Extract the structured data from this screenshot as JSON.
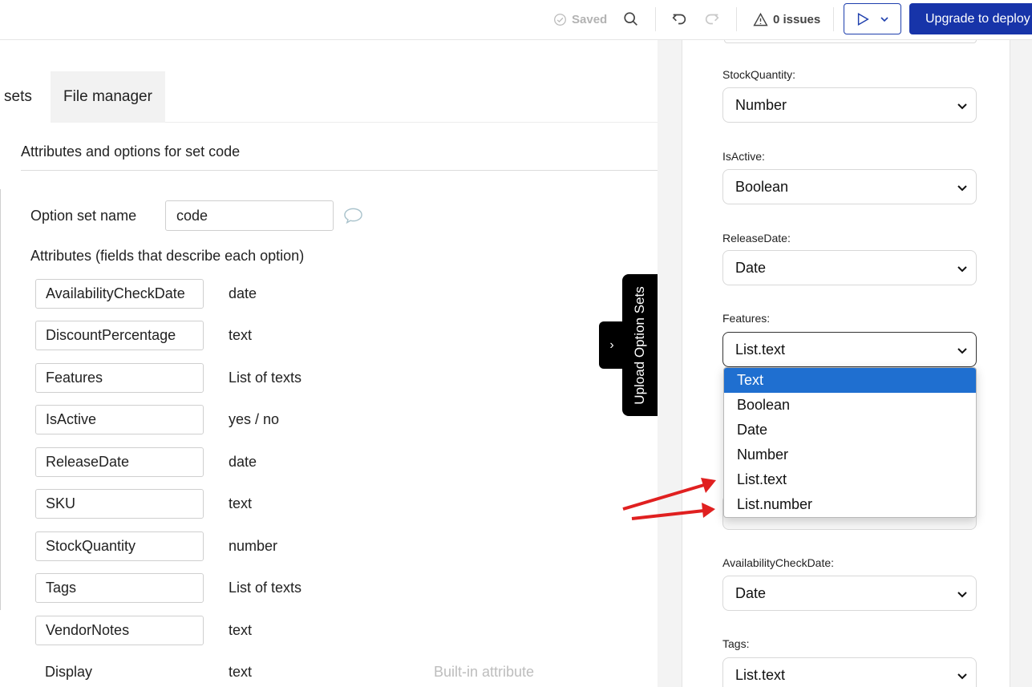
{
  "topbar": {
    "saved_label": "Saved",
    "issues_label": "0 issues",
    "upgrade_label": "Upgrade to deploy"
  },
  "tabs": {
    "sets_label": "sets",
    "file_manager_label": "File manager"
  },
  "editor": {
    "section_title": "Attributes and options for set code",
    "option_set_name_label": "Option set name",
    "option_set_name_value": "code",
    "attributes_label": "Attributes (fields that describe each option)",
    "attributes": [
      {
        "name": "AvailabilityCheckDate",
        "type": "date"
      },
      {
        "name": "DiscountPercentage",
        "type": "text"
      },
      {
        "name": "Features",
        "type": "List of texts"
      },
      {
        "name": "IsActive",
        "type": "yes / no"
      },
      {
        "name": "ReleaseDate",
        "type": "date"
      },
      {
        "name": "SKU",
        "type": "text"
      },
      {
        "name": "StockQuantity",
        "type": "number"
      },
      {
        "name": "Tags",
        "type": "List of texts"
      },
      {
        "name": "VendorNotes",
        "type": "text"
      }
    ],
    "builtin": {
      "name": "Display",
      "type": "text",
      "note": "Built-in attribute"
    }
  },
  "upload_tab": {
    "label": "Upload Option Sets",
    "chevron": "›"
  },
  "panel": {
    "fields": [
      {
        "label": "StockQuantity:",
        "value": "Number"
      },
      {
        "label": "IsActive:",
        "value": "Boolean"
      },
      {
        "label": "ReleaseDate:",
        "value": "Date"
      },
      {
        "label": "Features:",
        "value": "List.text"
      },
      {
        "label": "AvailabilityCheckDate:",
        "value": "Date"
      },
      {
        "label": "Tags:",
        "value": "List.text"
      }
    ],
    "dropdown_options": [
      "Text",
      "Boolean",
      "Date",
      "Number",
      "List.text",
      "List.number"
    ],
    "dropdown_highlighted": "Text"
  },
  "colors": {
    "primary": "#1734a9",
    "highlight": "#1f6fd0",
    "arrow": "#e02020"
  }
}
